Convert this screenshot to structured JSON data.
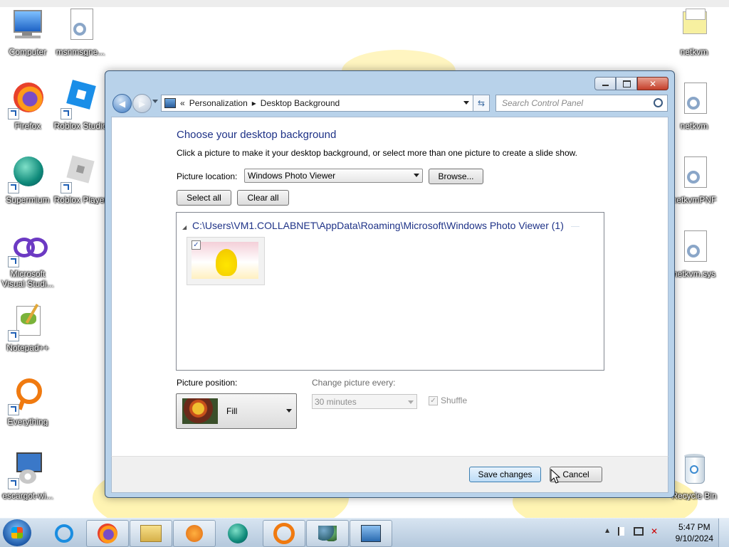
{
  "desktop": {
    "icons_left": [
      {
        "label": "Computer",
        "icon": "computer-icon"
      },
      {
        "label": "msnmsgne...",
        "icon": "settings-file-icon"
      },
      {
        "label": "Firefox",
        "icon": "firefox-icon"
      },
      {
        "label": "Roblox Studio",
        "icon": "roblox-studio-icon"
      },
      {
        "label": "Supermium",
        "icon": "supermium-icon"
      },
      {
        "label": "Roblox Player",
        "icon": "roblox-player-icon"
      },
      {
        "label": "Microsoft Visual Studi...",
        "icon": "visual-studio-icon"
      },
      {
        "label": "Notepad++",
        "icon": "notepadpp-icon"
      },
      {
        "label": "Everything",
        "icon": "everything-search-icon"
      },
      {
        "label": "escargot-wi...",
        "icon": "installer-icon"
      }
    ],
    "icons_right": [
      {
        "label": "netkvm",
        "icon": "folder-stack-icon"
      },
      {
        "label": "netkvm",
        "icon": "settings-file-icon"
      },
      {
        "label": "netkvmPNF",
        "icon": "settings-file-icon"
      },
      {
        "label": "netkvm.sys",
        "icon": "settings-file-icon"
      },
      {
        "label": "Recycle Bin",
        "icon": "recycle-bin-icon"
      }
    ]
  },
  "window": {
    "breadcrumb": {
      "prefix": "«",
      "parent": "Personalization",
      "sep": "▸",
      "current": "Desktop Background"
    },
    "search_placeholder": "Search Control Panel",
    "heading": "Choose your desktop background",
    "description": "Click a picture to make it your desktop background, or select more than one picture to create a slide show.",
    "picture_location_label": "Picture location:",
    "picture_location_value": "Windows Photo Viewer",
    "browse_label": "Browse...",
    "select_all_label": "Select all",
    "clear_all_label": "Clear all",
    "group_path": "C:\\Users\\VM1.COLLABNET\\AppData\\Roaming\\Microsoft\\Windows Photo Viewer (1)",
    "group_collapse": "◢",
    "thumb_checked": "✓",
    "picture_position_label": "Picture position:",
    "picture_position_value": "Fill",
    "change_every_label": "Change picture every:",
    "change_every_value": "30 minutes",
    "shuffle_label": "Shuffle",
    "shuffle_check": "✓",
    "save_label": "Save changes",
    "cancel_label": "Cancel"
  },
  "taskbar": {
    "apps": [
      "internet-explorer-icon",
      "firefox-icon",
      "file-explorer-icon",
      "media-player-icon",
      "supermium-icon",
      "everything-search-icon",
      "users-icon",
      "control-panel-icon"
    ],
    "tray_arrow": "▲",
    "time": "5:47 PM",
    "date": "9/10/2024"
  },
  "colors": {
    "heading_blue": "#1e3287",
    "window_frame": "#b8d2ea",
    "taskbar": "#c7d8ea"
  }
}
